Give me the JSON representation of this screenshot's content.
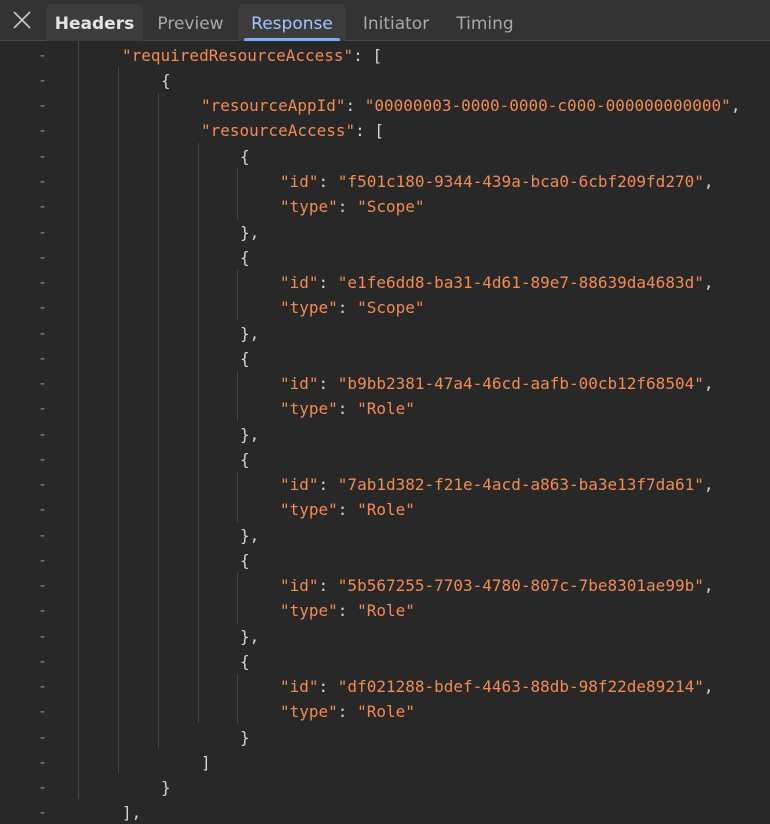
{
  "tabs": {
    "headers": "Headers",
    "preview": "Preview",
    "response": "Response",
    "initiator": "Initiator",
    "timing": "Timing",
    "active": "Response"
  },
  "icons": {
    "close": "close-icon"
  },
  "colors": {
    "background": "#282828",
    "tabbar": "#333333",
    "string": "#f28b54",
    "punctuation": "#d4d4d4",
    "active_tab_text": "#9ec7ff",
    "active_tab_underline": "#7cacf8"
  },
  "gutter_marker": "-",
  "code": {
    "required_resource_access_key": "\"requiredResourceAccess\"",
    "resource_app_id_key": "\"resourceAppId\"",
    "resource_app_id_value": "\"00000003-0000-0000-c000-000000000000\"",
    "resource_access_key": "\"resourceAccess\"",
    "id_key": "\"id\"",
    "type_key": "\"type\"",
    "entries": [
      {
        "id": "\"f501c180-9344-439a-bca0-6cbf209fd270\"",
        "type": "\"Scope\""
      },
      {
        "id": "\"e1fe6dd8-ba31-4d61-89e7-88639da4683d\"",
        "type": "\"Scope\""
      },
      {
        "id": "\"b9bb2381-47a4-46cd-aafb-00cb12f68504\"",
        "type": "\"Role\""
      },
      {
        "id": "\"7ab1d382-f21e-4acd-a863-ba3e13f7da61\"",
        "type": "\"Role\""
      },
      {
        "id": "\"5b567255-7703-4780-807c-7be8301ae99b\"",
        "type": "\"Role\""
      },
      {
        "id": "\"df021288-bdef-4463-88db-98f22de89214\"",
        "type": "\"Role\""
      }
    ]
  }
}
